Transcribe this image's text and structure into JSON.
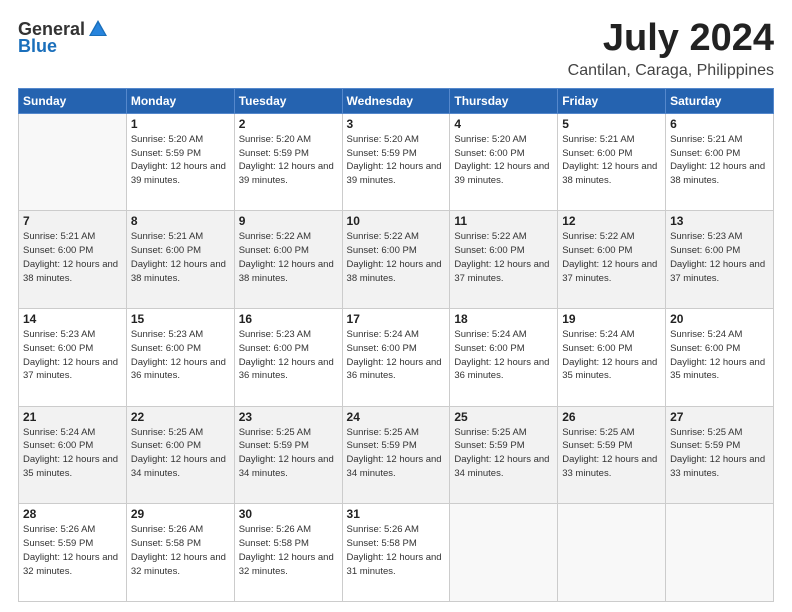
{
  "logo": {
    "general": "General",
    "blue": "Blue"
  },
  "title": "July 2024",
  "location": "Cantilan, Caraga, Philippines",
  "days_of_week": [
    "Sunday",
    "Monday",
    "Tuesday",
    "Wednesday",
    "Thursday",
    "Friday",
    "Saturday"
  ],
  "weeks": [
    [
      {
        "day": "",
        "sunrise": "",
        "sunset": "",
        "daylight": ""
      },
      {
        "day": "1",
        "sunrise": "Sunrise: 5:20 AM",
        "sunset": "Sunset: 5:59 PM",
        "daylight": "Daylight: 12 hours and 39 minutes."
      },
      {
        "day": "2",
        "sunrise": "Sunrise: 5:20 AM",
        "sunset": "Sunset: 5:59 PM",
        "daylight": "Daylight: 12 hours and 39 minutes."
      },
      {
        "day": "3",
        "sunrise": "Sunrise: 5:20 AM",
        "sunset": "Sunset: 5:59 PM",
        "daylight": "Daylight: 12 hours and 39 minutes."
      },
      {
        "day": "4",
        "sunrise": "Sunrise: 5:20 AM",
        "sunset": "Sunset: 6:00 PM",
        "daylight": "Daylight: 12 hours and 39 minutes."
      },
      {
        "day": "5",
        "sunrise": "Sunrise: 5:21 AM",
        "sunset": "Sunset: 6:00 PM",
        "daylight": "Daylight: 12 hours and 38 minutes."
      },
      {
        "day": "6",
        "sunrise": "Sunrise: 5:21 AM",
        "sunset": "Sunset: 6:00 PM",
        "daylight": "Daylight: 12 hours and 38 minutes."
      }
    ],
    [
      {
        "day": "7",
        "sunrise": "Sunrise: 5:21 AM",
        "sunset": "Sunset: 6:00 PM",
        "daylight": "Daylight: 12 hours and 38 minutes."
      },
      {
        "day": "8",
        "sunrise": "Sunrise: 5:21 AM",
        "sunset": "Sunset: 6:00 PM",
        "daylight": "Daylight: 12 hours and 38 minutes."
      },
      {
        "day": "9",
        "sunrise": "Sunrise: 5:22 AM",
        "sunset": "Sunset: 6:00 PM",
        "daylight": "Daylight: 12 hours and 38 minutes."
      },
      {
        "day": "10",
        "sunrise": "Sunrise: 5:22 AM",
        "sunset": "Sunset: 6:00 PM",
        "daylight": "Daylight: 12 hours and 38 minutes."
      },
      {
        "day": "11",
        "sunrise": "Sunrise: 5:22 AM",
        "sunset": "Sunset: 6:00 PM",
        "daylight": "Daylight: 12 hours and 37 minutes."
      },
      {
        "day": "12",
        "sunrise": "Sunrise: 5:22 AM",
        "sunset": "Sunset: 6:00 PM",
        "daylight": "Daylight: 12 hours and 37 minutes."
      },
      {
        "day": "13",
        "sunrise": "Sunrise: 5:23 AM",
        "sunset": "Sunset: 6:00 PM",
        "daylight": "Daylight: 12 hours and 37 minutes."
      }
    ],
    [
      {
        "day": "14",
        "sunrise": "Sunrise: 5:23 AM",
        "sunset": "Sunset: 6:00 PM",
        "daylight": "Daylight: 12 hours and 37 minutes."
      },
      {
        "day": "15",
        "sunrise": "Sunrise: 5:23 AM",
        "sunset": "Sunset: 6:00 PM",
        "daylight": "Daylight: 12 hours and 36 minutes."
      },
      {
        "day": "16",
        "sunrise": "Sunrise: 5:23 AM",
        "sunset": "Sunset: 6:00 PM",
        "daylight": "Daylight: 12 hours and 36 minutes."
      },
      {
        "day": "17",
        "sunrise": "Sunrise: 5:24 AM",
        "sunset": "Sunset: 6:00 PM",
        "daylight": "Daylight: 12 hours and 36 minutes."
      },
      {
        "day": "18",
        "sunrise": "Sunrise: 5:24 AM",
        "sunset": "Sunset: 6:00 PM",
        "daylight": "Daylight: 12 hours and 36 minutes."
      },
      {
        "day": "19",
        "sunrise": "Sunrise: 5:24 AM",
        "sunset": "Sunset: 6:00 PM",
        "daylight": "Daylight: 12 hours and 35 minutes."
      },
      {
        "day": "20",
        "sunrise": "Sunrise: 5:24 AM",
        "sunset": "Sunset: 6:00 PM",
        "daylight": "Daylight: 12 hours and 35 minutes."
      }
    ],
    [
      {
        "day": "21",
        "sunrise": "Sunrise: 5:24 AM",
        "sunset": "Sunset: 6:00 PM",
        "daylight": "Daylight: 12 hours and 35 minutes."
      },
      {
        "day": "22",
        "sunrise": "Sunrise: 5:25 AM",
        "sunset": "Sunset: 6:00 PM",
        "daylight": "Daylight: 12 hours and 34 minutes."
      },
      {
        "day": "23",
        "sunrise": "Sunrise: 5:25 AM",
        "sunset": "Sunset: 5:59 PM",
        "daylight": "Daylight: 12 hours and 34 minutes."
      },
      {
        "day": "24",
        "sunrise": "Sunrise: 5:25 AM",
        "sunset": "Sunset: 5:59 PM",
        "daylight": "Daylight: 12 hours and 34 minutes."
      },
      {
        "day": "25",
        "sunrise": "Sunrise: 5:25 AM",
        "sunset": "Sunset: 5:59 PM",
        "daylight": "Daylight: 12 hours and 34 minutes."
      },
      {
        "day": "26",
        "sunrise": "Sunrise: 5:25 AM",
        "sunset": "Sunset: 5:59 PM",
        "daylight": "Daylight: 12 hours and 33 minutes."
      },
      {
        "day": "27",
        "sunrise": "Sunrise: 5:25 AM",
        "sunset": "Sunset: 5:59 PM",
        "daylight": "Daylight: 12 hours and 33 minutes."
      }
    ],
    [
      {
        "day": "28",
        "sunrise": "Sunrise: 5:26 AM",
        "sunset": "Sunset: 5:59 PM",
        "daylight": "Daylight: 12 hours and 32 minutes."
      },
      {
        "day": "29",
        "sunrise": "Sunrise: 5:26 AM",
        "sunset": "Sunset: 5:58 PM",
        "daylight": "Daylight: 12 hours and 32 minutes."
      },
      {
        "day": "30",
        "sunrise": "Sunrise: 5:26 AM",
        "sunset": "Sunset: 5:58 PM",
        "daylight": "Daylight: 12 hours and 32 minutes."
      },
      {
        "day": "31",
        "sunrise": "Sunrise: 5:26 AM",
        "sunset": "Sunset: 5:58 PM",
        "daylight": "Daylight: 12 hours and 31 minutes."
      },
      {
        "day": "",
        "sunrise": "",
        "sunset": "",
        "daylight": ""
      },
      {
        "day": "",
        "sunrise": "",
        "sunset": "",
        "daylight": ""
      },
      {
        "day": "",
        "sunrise": "",
        "sunset": "",
        "daylight": ""
      }
    ]
  ]
}
